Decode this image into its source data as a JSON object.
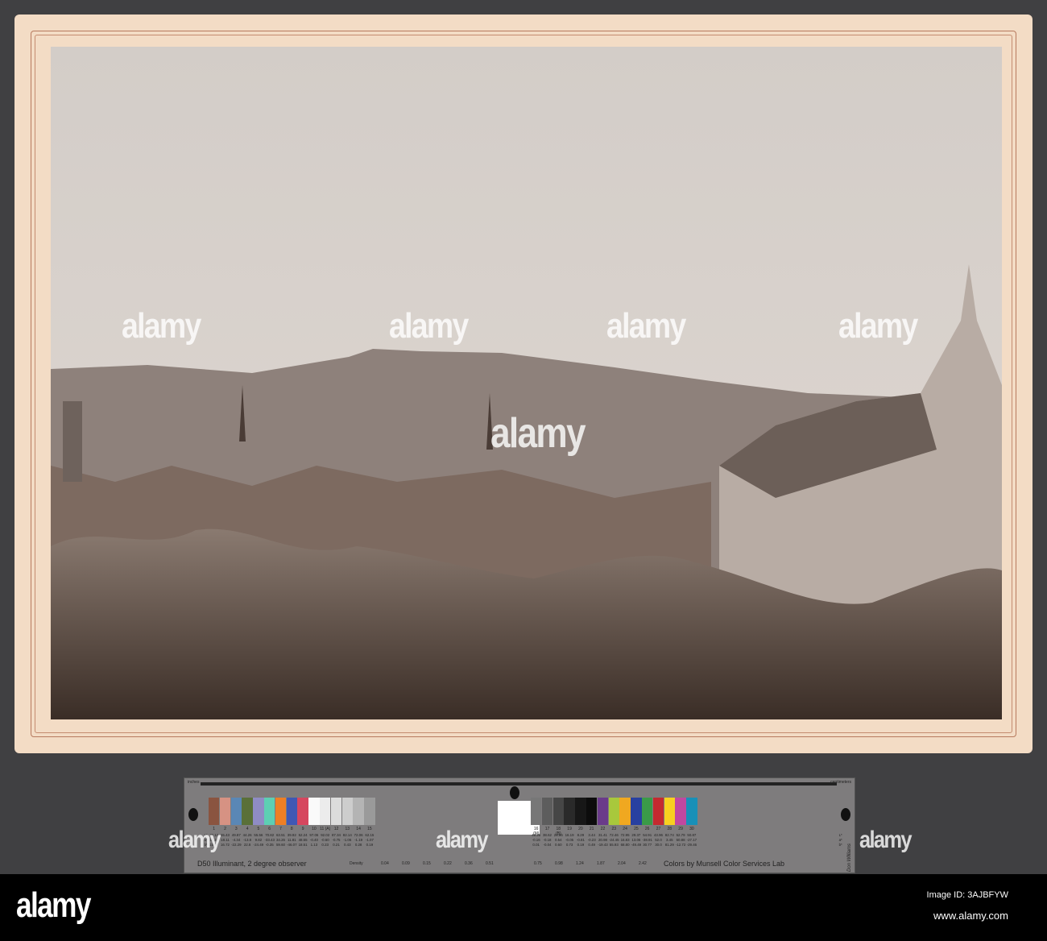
{
  "watermark": "alamy",
  "chart": {
    "inches": "inches",
    "centimeters": "centimeters",
    "left_caption": "D50 Illuminant, 2 degree observer",
    "density_label": "Density",
    "right_caption": "Colors by Munsell Color Services Lab",
    "signature": "Don Williams",
    "row_labels": [
      "L*",
      "a*",
      "b*"
    ],
    "patches": [
      {
        "n": "1",
        "c": "#8a5440",
        "v": [
          "39.12",
          "13.24",
          "15.07"
        ]
      },
      {
        "n": "2",
        "c": "#d69283",
        "v": [
          "65.43",
          "18.11",
          "16.72"
        ]
      },
      {
        "n": "3",
        "c": "#5a87b5",
        "v": [
          "49.87",
          "-4.34",
          "-22.29"
        ]
      },
      {
        "n": "4",
        "c": "#5a7038",
        "v": [
          "44.26",
          "-13.8",
          "22.8"
        ]
      },
      {
        "n": "5",
        "c": "#8f8cc4",
        "v": [
          "55.56",
          "9.82",
          "-24.49"
        ]
      },
      {
        "n": "6",
        "c": "#5dcfb3",
        "v": [
          "70.82",
          "-33.43",
          "-0.35"
        ]
      },
      {
        "n": "7",
        "c": "#ee7f24",
        "v": [
          "63.51",
          "34.26",
          "59.60"
        ]
      },
      {
        "n": "8",
        "c": "#3f58b4",
        "v": [
          "39.92",
          "11.81",
          "-46.07"
        ]
      },
      {
        "n": "9",
        "c": "#d6475f",
        "v": [
          "52.24",
          "48.55",
          "18.51"
        ]
      },
      {
        "n": "10",
        "c": "#fafafa",
        "v": [
          "97.06",
          "-0.40",
          "1.13"
        ]
      },
      {
        "n": "11 (A)",
        "c": "#ececec",
        "v": [
          "92.02",
          "-0.60",
          "0.23"
        ]
      },
      {
        "n": "12",
        "c": "#dcdcdc",
        "v": [
          "87.34",
          "-0.75",
          "0.21"
        ]
      },
      {
        "n": "13",
        "c": "#cdcdcd",
        "v": [
          "82.14",
          "-1.06",
          "0.43"
        ]
      },
      {
        "n": "14",
        "c": "#b4b4b4",
        "v": [
          "72.06",
          "-1.19",
          "0.28"
        ]
      },
      {
        "n": "15",
        "c": "#9a9a9a",
        "v": [
          "62.15",
          "-1.07",
          "0.19"
        ]
      },
      {
        "n": "16 (M)",
        "c": "#777777",
        "v": [
          "49.25",
          "-0.16",
          "0.01"
        ]
      },
      {
        "n": "17",
        "c": "#5d5d5d",
        "v": [
          "38.62",
          "-0.18",
          "-0.04"
        ]
      },
      {
        "n": "18 (B)",
        "c": "#464646",
        "v": [
          "28.86",
          "0.54",
          "0.60"
        ]
      },
      {
        "n": "19",
        "c": "#2a2a2a",
        "v": [
          "16.19",
          "-0.05",
          "0.73"
        ]
      },
      {
        "n": "20",
        "c": "#171717",
        "v": [
          "8.29",
          "-0.81",
          "0.19"
        ]
      },
      {
        "n": "21",
        "c": "#0c0c0c",
        "v": [
          "3.44",
          "-0.23",
          "0.49"
        ]
      },
      {
        "n": "22",
        "c": "#6a3b8a",
        "v": [
          "31.41",
          "20.98",
          "-19.43"
        ]
      },
      {
        "n": "23",
        "c": "#a8c83c",
        "v": [
          "72.46",
          "-24.45",
          "55.93"
        ]
      },
      {
        "n": "24",
        "c": "#f0a820",
        "v": [
          "72.95",
          "16.83",
          "68.80"
        ]
      },
      {
        "n": "25",
        "c": "#2840a0",
        "v": [
          "29.37",
          "13.06",
          "-49.49"
        ]
      },
      {
        "n": "26",
        "c": "#3a9a48",
        "v": [
          "54.91",
          "-38.91",
          "30.77"
        ]
      },
      {
        "n": "27",
        "c": "#c42a30",
        "v": [
          "43.96",
          "52.0",
          "30.0"
        ]
      },
      {
        "n": "28",
        "c": "#f8d020",
        "v": [
          "82.74",
          "3.45",
          "81.29"
        ]
      },
      {
        "n": "29",
        "c": "#c048a0",
        "v": [
          "52.79",
          "50.88",
          "-12.72"
        ]
      },
      {
        "n": "30",
        "c": "#1890b8",
        "v": [
          "50.87",
          "-27.17",
          "-29.46"
        ]
      }
    ],
    "density_left": [
      "0.04",
      "0.09",
      "0.15",
      "0.22",
      "0.36",
      "0.51"
    ],
    "density_right": [
      "0.75",
      "0.98",
      "1.24",
      "1.87",
      "2.04",
      "2.42"
    ]
  },
  "footer": {
    "logo": "alamy",
    "image_id": "Image ID: 3AJBFYW",
    "url": "www.alamy.com"
  }
}
